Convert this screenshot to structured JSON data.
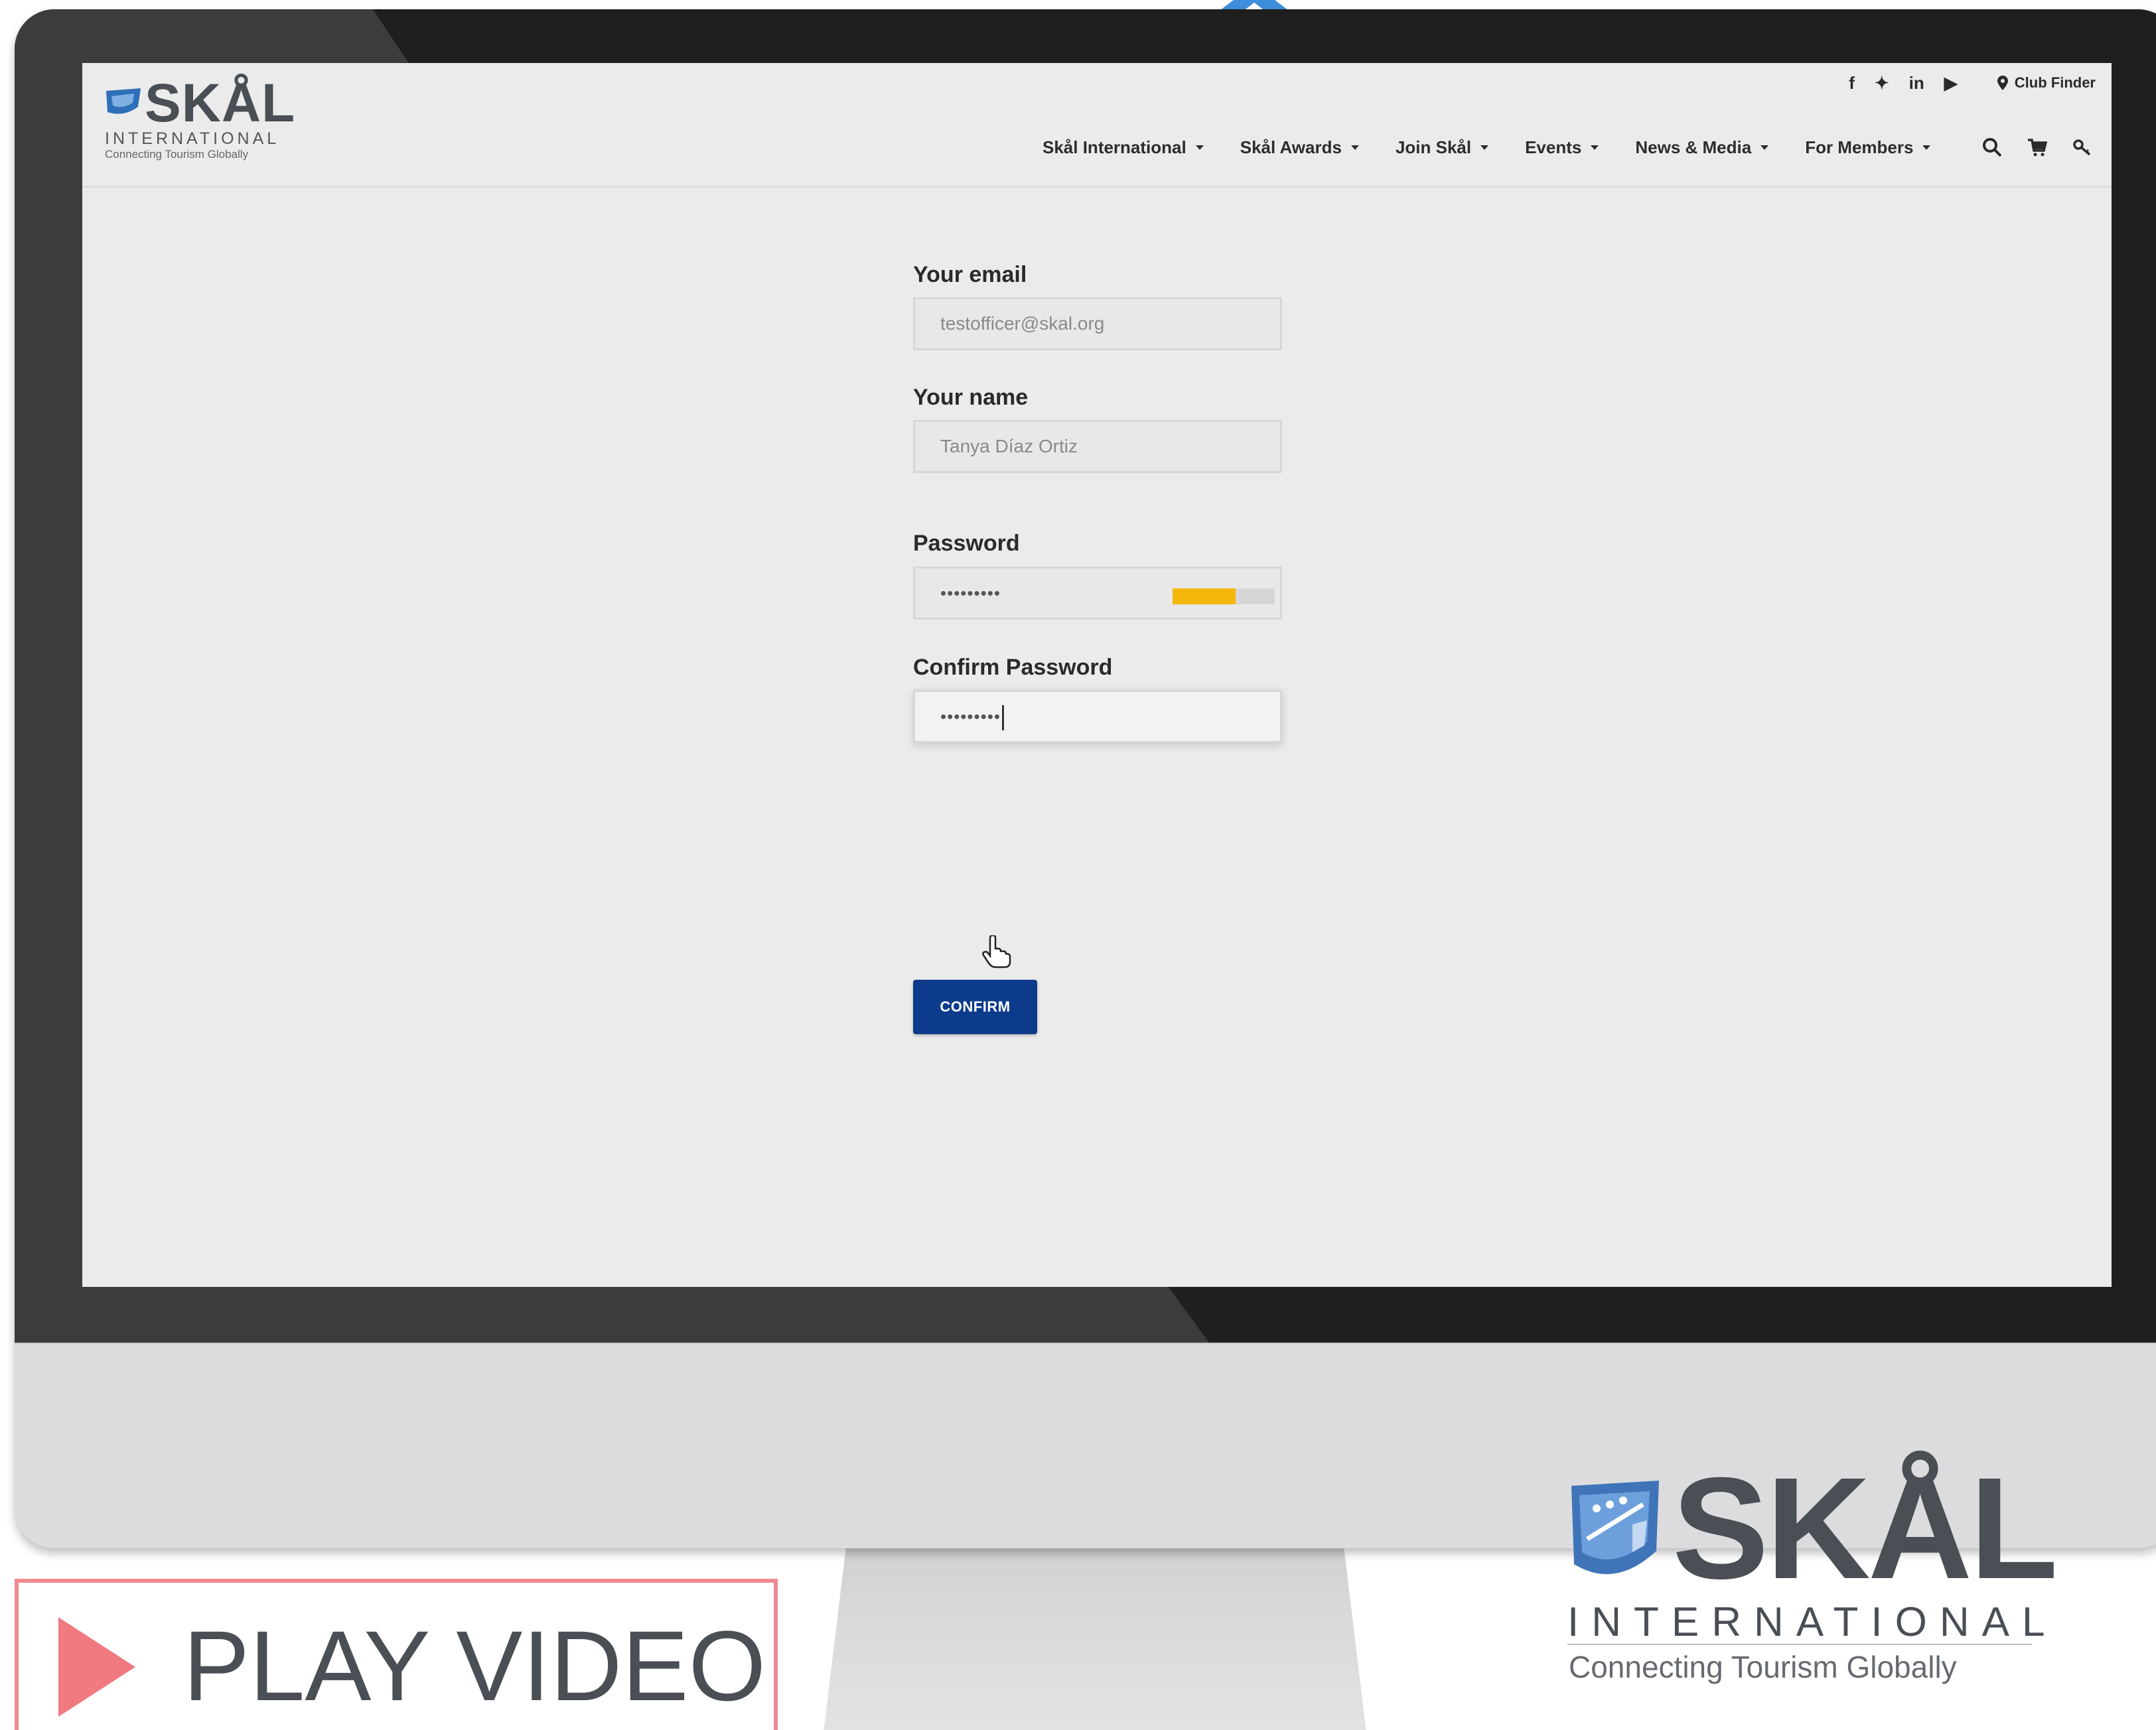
{
  "site": {
    "logo": {
      "word": "SKÅL",
      "international": "INTERNATIONAL",
      "tagline": "Connecting Tourism Globally"
    },
    "social_icons": [
      "facebook-icon",
      "twitter-icon",
      "linkedin-icon",
      "youtube-icon"
    ],
    "social_glyphs": {
      "facebook": "f",
      "twitter": "✦",
      "linkedin": "in",
      "youtube": "▶"
    },
    "club_finder": "Club Finder",
    "nav": [
      {
        "label": "Skål International"
      },
      {
        "label": "Skål Awards"
      },
      {
        "label": "Join Skål"
      },
      {
        "label": "Events"
      },
      {
        "label": "News & Media"
      },
      {
        "label": "For Members"
      }
    ],
    "tools": [
      "search-icon",
      "cart-icon",
      "key-icon"
    ]
  },
  "form": {
    "email_label": "Your email",
    "email_value": "testofficer@skal.org",
    "name_label": "Your name",
    "name_value": "Tanya Díaz Ortiz",
    "password_label": "Password",
    "password_value": "•••••••••",
    "password_strength": 0.62,
    "strength_color": "#f5b70a",
    "confirm_label": "Confirm Password",
    "confirm_value": "•••••••••",
    "confirm_button": "CONFIRM",
    "button_color": "#0d3b8c"
  },
  "brand": {
    "word": "SKÅL",
    "international": "INTERNATIONAL",
    "tagline": "Connecting Tourism Globally"
  },
  "play_video": {
    "label": "PLAY VIDEO",
    "accent": "#f07a80"
  }
}
